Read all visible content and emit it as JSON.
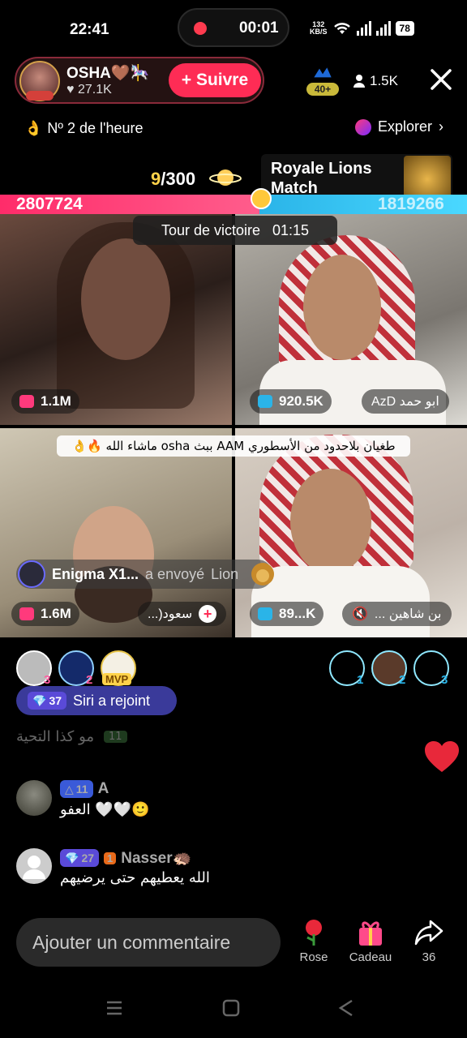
{
  "status_bar": {
    "time": "22:41",
    "recording_time": "00:01",
    "network_speed": "132",
    "network_unit": "KB/S",
    "battery": "78"
  },
  "host": {
    "name": "OSHA🤎🎠",
    "likes": "27.1K",
    "follow_label": "Suivre",
    "rank_badge": "40+",
    "viewers": "1.5K"
  },
  "ranking": {
    "hourly": "Nº 2 de l'heure",
    "explorer": "Explorer"
  },
  "match": {
    "counter_current": "9",
    "counter_total": "/300",
    "title": "Royale Lions Match",
    "score_left": "2807724",
    "score_right": "1819266",
    "victory_label": "Tour de victoire",
    "victory_time": "01:15"
  },
  "tiles": [
    {
      "score": "1.1M",
      "name": ""
    },
    {
      "score": "920.5K",
      "name": "ابو حمد AzD"
    },
    {
      "score": "1.6M",
      "name": "سعود(..."
    },
    {
      "score": "89...K",
      "name": "بن شاهين ..."
    }
  ],
  "banner": {
    "text": "طغيان بلاحدود من الأسطوري AAM ببث osha ماشاء الله 🔥👌"
  },
  "gift_notice": {
    "user": "Enigma X1...",
    "action": "a envoyé",
    "gift": "Lion"
  },
  "supporters_left": [
    "3",
    "2",
    "MVP"
  ],
  "supporters_right": [
    "1",
    "2",
    "3"
  ],
  "joined": {
    "level": "37",
    "text": "Siri a rejoint"
  },
  "faded_comment": {
    "level": "11",
    "text": "مو كذا التحية"
  },
  "comments": [
    {
      "level": "11",
      "user": "A",
      "text": "العفو 🤍🤍🙂"
    },
    {
      "level": "27",
      "user": "Nasser🦔",
      "text": "الله يعطيهم حتى يرضيهم"
    }
  ],
  "bottom": {
    "comment_placeholder": "Ajouter un commentaire",
    "rose_label": "Rose",
    "gift_label": "Cadeau",
    "share_count": "36"
  },
  "colors": {
    "accent": "#fe2c55",
    "team_left": "#ff2c6a",
    "team_right": "#2ab4e8"
  }
}
